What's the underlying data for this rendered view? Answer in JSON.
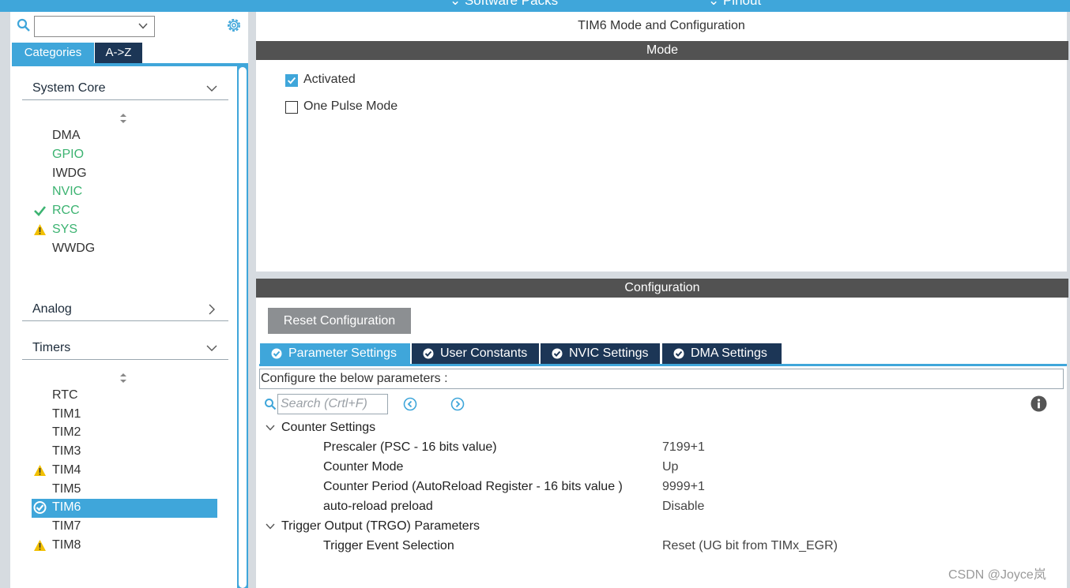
{
  "top_bar": {
    "software_packs": "⌄  Software Packs",
    "pinout": "⌄  Pinout"
  },
  "sidebar": {
    "search": {
      "value": ""
    },
    "tabs": {
      "categories": "Categories",
      "az": "A->Z"
    },
    "sections": [
      {
        "label": "System Core",
        "expanded": true,
        "items": [
          {
            "label": "DMA",
            "status": "none"
          },
          {
            "label": "GPIO",
            "status": "configured"
          },
          {
            "label": "IWDG",
            "status": "none"
          },
          {
            "label": "NVIC",
            "status": "configured"
          },
          {
            "label": "RCC",
            "status": "ok"
          },
          {
            "label": "SYS",
            "status": "warning"
          },
          {
            "label": "WWDG",
            "status": "none"
          }
        ]
      },
      {
        "label": "Analog",
        "expanded": false
      },
      {
        "label": "Timers",
        "expanded": true,
        "items": [
          {
            "label": "RTC",
            "status": "none"
          },
          {
            "label": "TIM1",
            "status": "none"
          },
          {
            "label": "TIM2",
            "status": "none"
          },
          {
            "label": "TIM3",
            "status": "none"
          },
          {
            "label": "TIM4",
            "status": "warning"
          },
          {
            "label": "TIM5",
            "status": "none"
          },
          {
            "label": "TIM6",
            "status": "selected-ok"
          },
          {
            "label": "TIM7",
            "status": "none"
          },
          {
            "label": "TIM8",
            "status": "warning"
          }
        ]
      }
    ]
  },
  "main": {
    "title": "TIM6 Mode and Configuration",
    "mode_header": "Mode",
    "mode_options": [
      {
        "label": "Activated",
        "checked": true
      },
      {
        "label": "One Pulse Mode",
        "checked": false
      }
    ],
    "config_header": "Configuration",
    "reset_button": "Reset Configuration",
    "tabs": [
      {
        "label": "Parameter Settings",
        "active": true
      },
      {
        "label": "User Constants",
        "active": false
      },
      {
        "label": "NVIC Settings",
        "active": false
      },
      {
        "label": "DMA Settings",
        "active": false
      }
    ],
    "hint": "Configure the below parameters :",
    "search_placeholder": "Search (Crtl+F)",
    "groups": [
      {
        "title": "Counter Settings",
        "params": [
          {
            "name": "Prescaler (PSC - 16 bits value)",
            "value": "7199+1"
          },
          {
            "name": "Counter Mode",
            "value": "Up"
          },
          {
            "name": "Counter Period (AutoReload Register - 16 bits value )",
            "value": "9999+1"
          },
          {
            "name": "auto-reload preload",
            "value": "Disable"
          }
        ]
      },
      {
        "title": "Trigger Output (TRGO) Parameters",
        "params": [
          {
            "name": "Trigger Event Selection",
            "value": "Reset (UG bit from TIMx_EGR)"
          }
        ]
      }
    ]
  },
  "watermark": "CSDN @Joyce岚",
  "colors": {
    "accent": "#3fa6da",
    "dark_tab": "#1c3656",
    "header_bar": "#525252",
    "configured": "#3cb371",
    "warning": "#f2c000"
  }
}
